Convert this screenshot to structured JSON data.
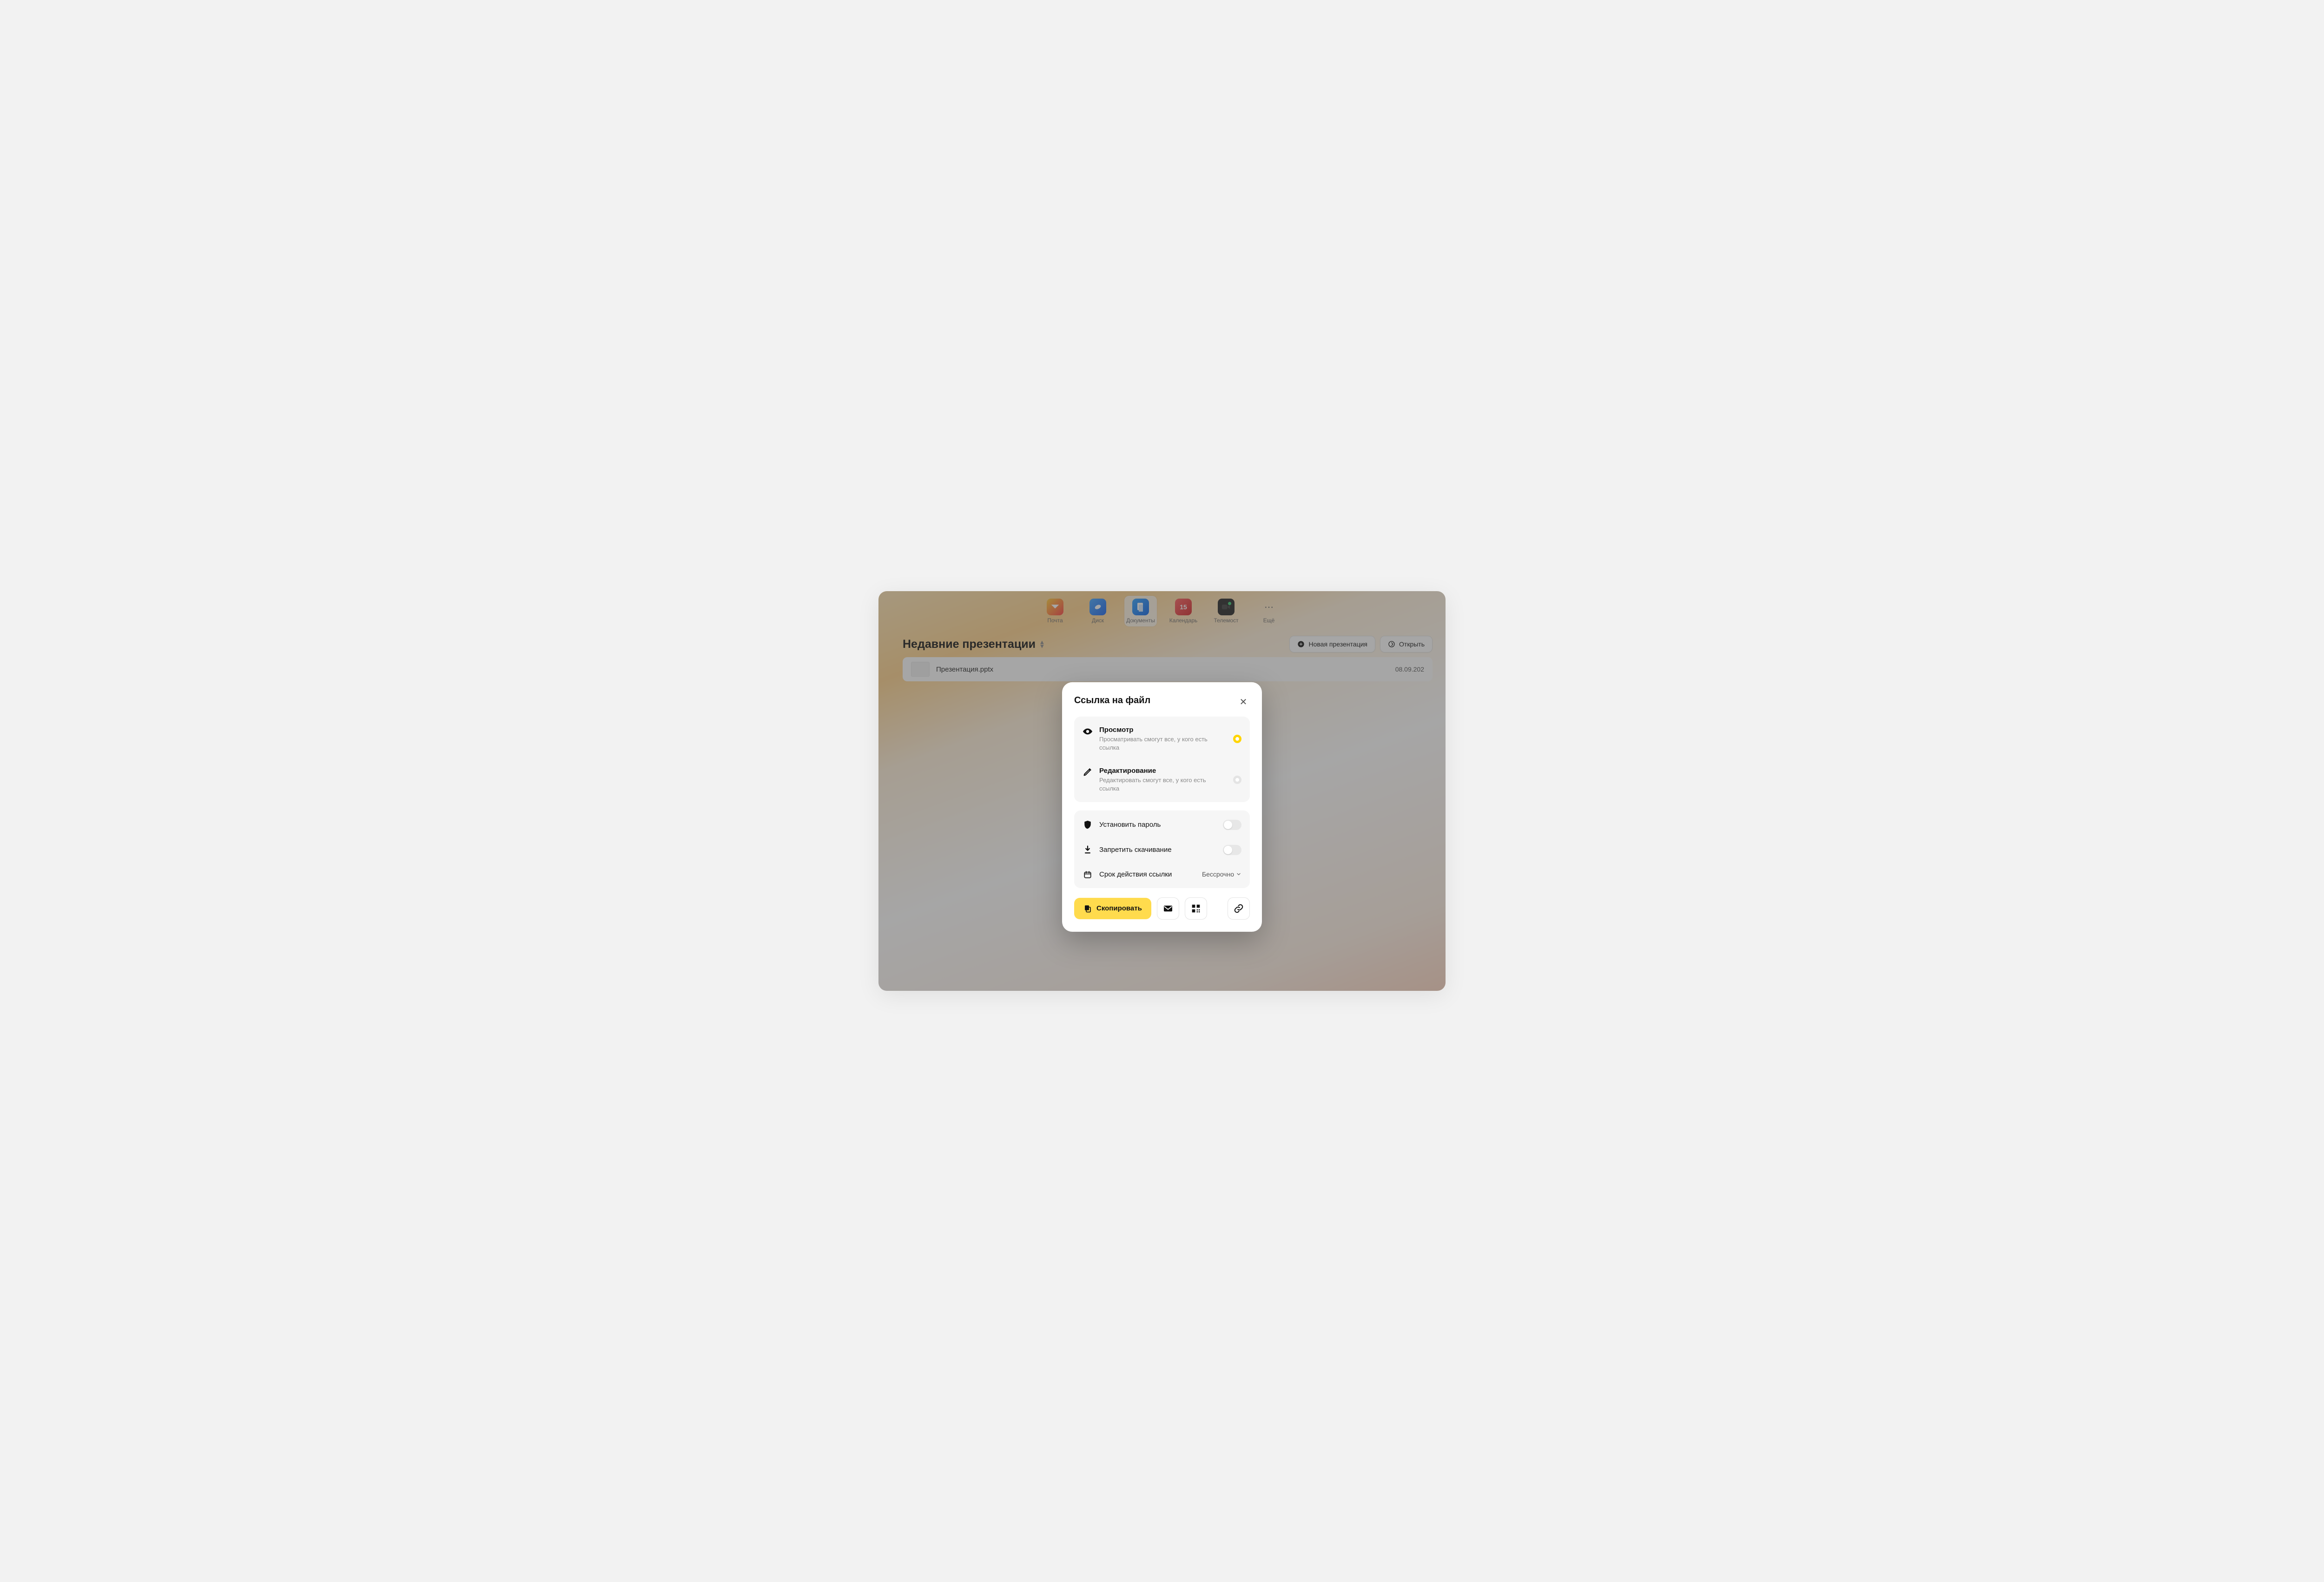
{
  "topnav": {
    "items": [
      {
        "label": "Почта",
        "id": "mail"
      },
      {
        "label": "Диск",
        "id": "disk"
      },
      {
        "label": "Документы",
        "id": "docs"
      },
      {
        "label": "Календарь",
        "id": "calendar",
        "badge": "15"
      },
      {
        "label": "Телемост",
        "id": "telemost"
      },
      {
        "label": "Ещё",
        "id": "more"
      }
    ],
    "active": "docs"
  },
  "page": {
    "title": "Недавние презентации",
    "actions": {
      "new_presentation": "Новая презентация",
      "open": "Открыть"
    },
    "files": [
      {
        "name": "Презентация.pptx",
        "date": "08.09.202"
      }
    ]
  },
  "modal": {
    "title": "Ссылка на файл",
    "options": {
      "view": {
        "title": "Просмотр",
        "desc": "Просматривать смогут все, у кого есть ссылка",
        "selected": true
      },
      "edit": {
        "title": "Редактирование",
        "desc": "Редактировать смогут все, у кого есть ссылка",
        "selected": false
      }
    },
    "settings": {
      "password": {
        "label": "Установить пароль",
        "on": false
      },
      "nodownload": {
        "label": "Запретить скачивание",
        "on": false
      },
      "expiry": {
        "label": "Срок действия ссылки",
        "value": "Бессрочно"
      }
    },
    "footer": {
      "copy": "Скопировать"
    }
  }
}
